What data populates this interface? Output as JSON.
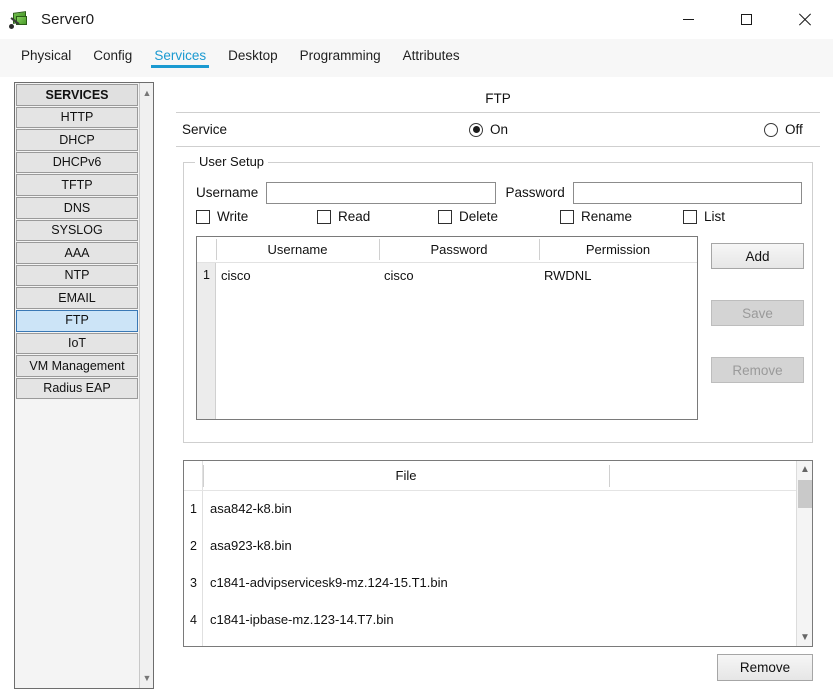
{
  "window": {
    "title": "Server0",
    "icon": "server-device-icon",
    "controls": {
      "minimize": "minimize-icon",
      "maximize": "maximize-icon",
      "close": "close-icon"
    }
  },
  "tabs": [
    {
      "label": "Physical",
      "active": false
    },
    {
      "label": "Config",
      "active": false
    },
    {
      "label": "Services",
      "active": true
    },
    {
      "label": "Desktop",
      "active": false
    },
    {
      "label": "Programming",
      "active": false
    },
    {
      "label": "Attributes",
      "active": false
    }
  ],
  "accent_color": "#1b9ad1",
  "sidebar": {
    "header": "SERVICES",
    "items": [
      {
        "label": "HTTP",
        "selected": false
      },
      {
        "label": "DHCP",
        "selected": false
      },
      {
        "label": "DHCPv6",
        "selected": false
      },
      {
        "label": "TFTP",
        "selected": false
      },
      {
        "label": "DNS",
        "selected": false
      },
      {
        "label": "SYSLOG",
        "selected": false
      },
      {
        "label": "AAA",
        "selected": false
      },
      {
        "label": "NTP",
        "selected": false
      },
      {
        "label": "EMAIL",
        "selected": false
      },
      {
        "label": "FTP",
        "selected": true
      },
      {
        "label": "IoT",
        "selected": false
      },
      {
        "label": "VM Management",
        "selected": false
      },
      {
        "label": "Radius EAP",
        "selected": false
      }
    ],
    "scroll_up": "chevron-up-icon",
    "scroll_down": "chevron-down-icon"
  },
  "main": {
    "title": "FTP",
    "service": {
      "label": "Service",
      "on_label": "On",
      "off_label": "Off",
      "selected": "On"
    },
    "user_setup": {
      "legend": "User Setup",
      "username_label": "Username",
      "username_value": "",
      "password_label": "Password",
      "password_value": "",
      "permissions": [
        {
          "label": "Write",
          "checked": false
        },
        {
          "label": "Read",
          "checked": false
        },
        {
          "label": "Delete",
          "checked": false
        },
        {
          "label": "Rename",
          "checked": false
        },
        {
          "label": "List",
          "checked": false
        }
      ],
      "table": {
        "columns": [
          "Username",
          "Password",
          "Permission"
        ],
        "rows": [
          {
            "index": "1",
            "username": "cisco",
            "password": "cisco",
            "permission": "RWDNL"
          }
        ]
      },
      "buttons": {
        "add": {
          "label": "Add",
          "enabled": true
        },
        "save": {
          "label": "Save",
          "enabled": false
        },
        "remove": {
          "label": "Remove",
          "enabled": false
        }
      }
    },
    "files": {
      "column": "File",
      "rows": [
        {
          "index": "1",
          "name": "asa842-k8.bin"
        },
        {
          "index": "2",
          "name": "asa923-k8.bin"
        },
        {
          "index": "3",
          "name": "c1841-advipservicesk9-mz.124-15.T1.bin"
        },
        {
          "index": "4",
          "name": "c1841-ipbase-mz.123-14.T7.bin"
        }
      ],
      "scroll_up": "chevron-up-icon",
      "scroll_down": "chevron-down-icon"
    },
    "remove_button": {
      "label": "Remove",
      "enabled": true
    }
  }
}
